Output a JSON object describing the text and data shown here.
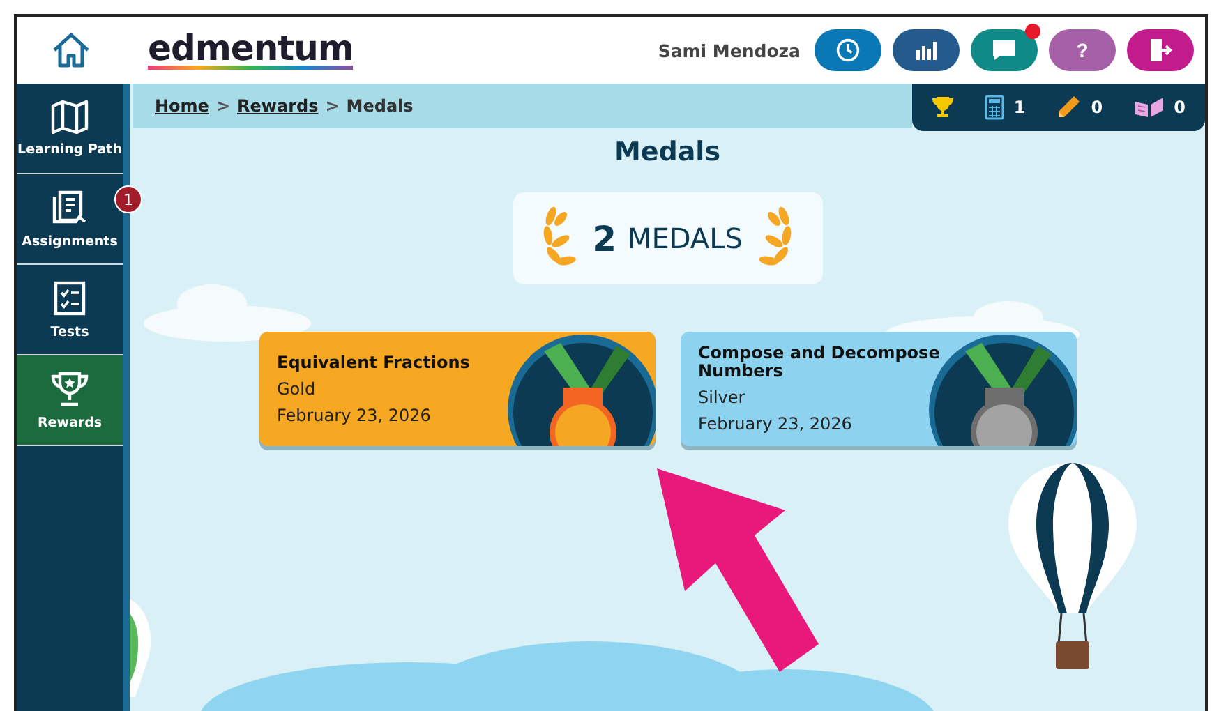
{
  "header": {
    "logo": "edmentum",
    "user_name": "Sami Mendoza",
    "buttons": [
      {
        "kind": "clock",
        "color": "#0a78b5",
        "notification": false
      },
      {
        "kind": "chart",
        "color": "#255b8c",
        "notification": false
      },
      {
        "kind": "chat",
        "color": "#0f8a86",
        "notification": true
      },
      {
        "kind": "help",
        "label": "?",
        "color": "#a560a8",
        "notification": false
      },
      {
        "kind": "logout",
        "color": "#c21c8c",
        "notification": false
      }
    ]
  },
  "sidebar": {
    "items": [
      {
        "kind": "map",
        "label": "Learning Path",
        "selected": false
      },
      {
        "kind": "assignments",
        "label": "Assignments",
        "selected": false,
        "badge": "1"
      },
      {
        "kind": "tests",
        "label": "Tests",
        "selected": false
      },
      {
        "kind": "trophy",
        "label": "Rewards",
        "selected": true
      }
    ]
  },
  "breadcrumb": {
    "links": [
      "Home",
      "Rewards"
    ],
    "separator": ">",
    "current": "Medals"
  },
  "stats": [
    {
      "kind": "trophy"
    },
    {
      "kind": "calculator",
      "count": "1"
    },
    {
      "kind": "pencil",
      "count": "0"
    },
    {
      "kind": "book",
      "count": "0"
    }
  ],
  "page_title": "Medals",
  "summary": {
    "count": "2",
    "label": "MEDALS"
  },
  "medals": [
    {
      "kind": "gold",
      "title": "Equivalent Fractions",
      "medal": "Gold",
      "date": "February 23, 2026"
    },
    {
      "kind": "silver",
      "title": "Compose and Decompose Numbers",
      "medal": "Silver",
      "date": "February 23, 2026"
    }
  ]
}
